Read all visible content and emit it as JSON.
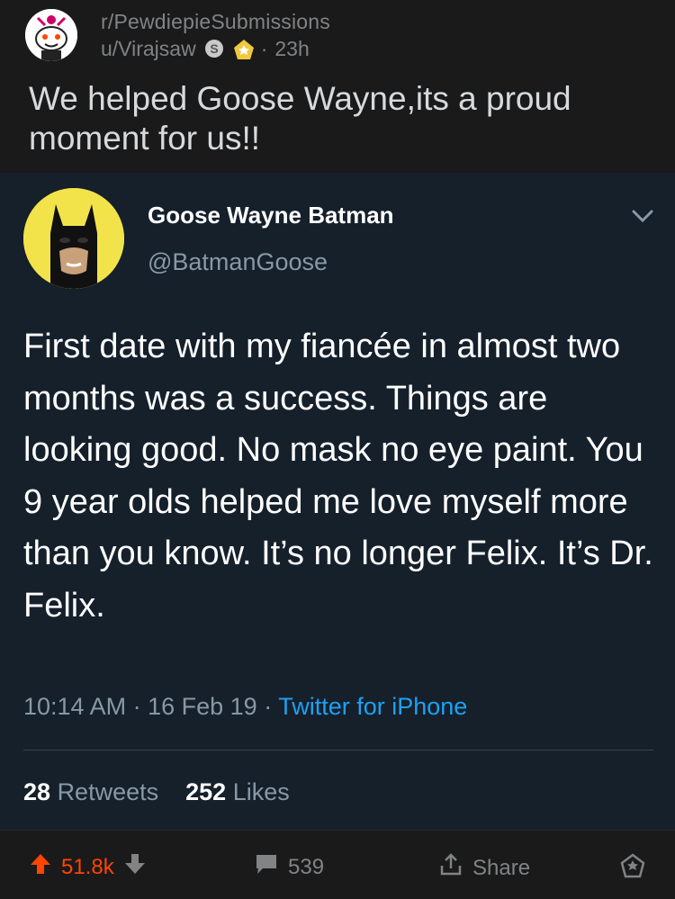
{
  "post": {
    "subreddit": "r/PewdiepieSubmissions",
    "author": "u/Virajsaw",
    "age": "23h",
    "title": "We helped Goose Wayne,its a proud moment for us!!"
  },
  "tweet": {
    "display_name": "Goose Wayne Batman",
    "handle": "@BatmanGoose",
    "text": "First date with my fiancée in almost two months was a success. Things are looking good. No mask no eye paint. You 9 year olds helped me love myself more than you know. It’s no longer Felix. It’s Dr. Felix.",
    "time": "10:14 AM",
    "date": "16 Feb 19",
    "source": "Twitter for iPhone",
    "retweets_count": "28",
    "retweets_label": "Retweets",
    "likes_count": "252",
    "likes_label": "Likes"
  },
  "actions": {
    "upvotes": "51.8k",
    "comments": "539",
    "share_label": "Share"
  },
  "colors": {
    "reddit_bg": "#1a1a1b",
    "tweet_bg": "#15202b",
    "upvote": "#ff4500",
    "link_blue": "#1da1f2",
    "avatar_yellow": "#f2e34a"
  },
  "icons": [
    "snoo-avatar-icon",
    "silver-award-icon",
    "gold-award-icon",
    "chevron-down-icon",
    "upvote-icon",
    "downvote-icon",
    "comment-icon",
    "share-icon",
    "award-icon"
  ]
}
